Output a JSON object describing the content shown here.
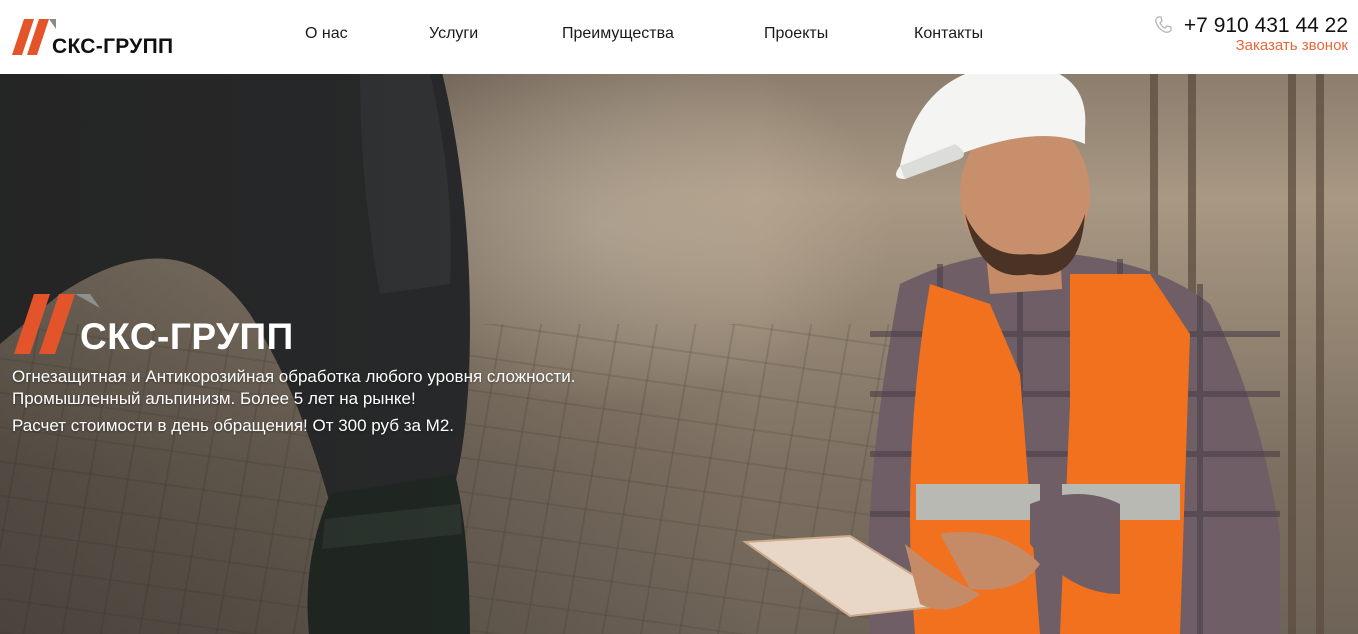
{
  "brand": {
    "name": "СКС-ГРУПП",
    "accent": "#e4542a",
    "accent_gray": "#8a8a8a"
  },
  "nav": {
    "items": [
      {
        "label": "О нас"
      },
      {
        "label": "Услуги"
      },
      {
        "label": "Преимущества"
      },
      {
        "label": "Проекты"
      },
      {
        "label": "Контакты"
      }
    ]
  },
  "contact": {
    "phone": "+7 910 431 44 22",
    "callback": "Заказать звонок",
    "phone_icon": "phone-icon",
    "callback_color": "#e4683a"
  },
  "hero": {
    "logo_text": "СКС-ГРУПП",
    "lines": [
      "Огнезащитная и Антикорозийная обработка любого уровня сложности.",
      "Промышленный альпинизм. Более 5 лет на рынке!",
      "Расчет стоимости в день обращения! От 300 руб за М2."
    ]
  }
}
